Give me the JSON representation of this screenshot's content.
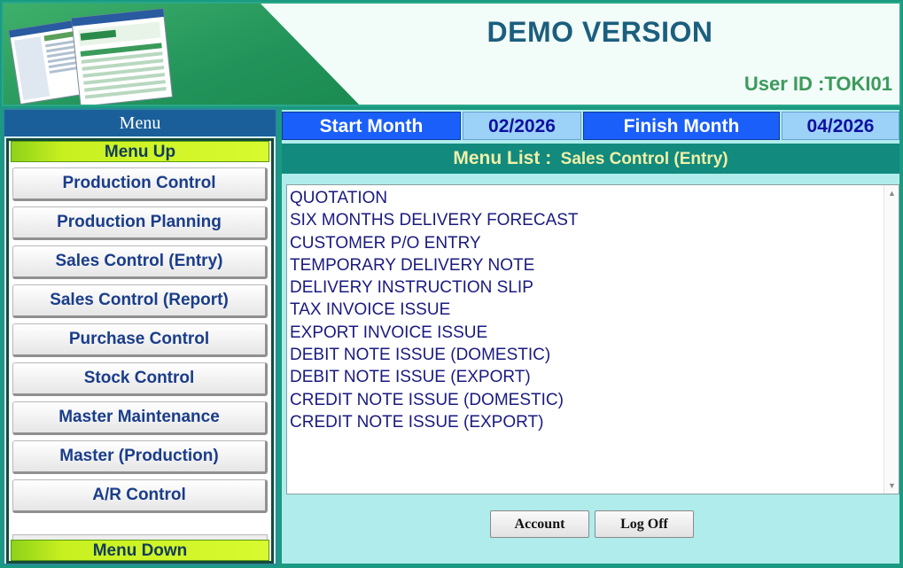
{
  "header": {
    "title": "DEMO VERSION",
    "user_id": "User ID :TOKI01"
  },
  "sidebar": {
    "title": "Menu",
    "menu_up": "Menu Up",
    "menu_down": "Menu Down",
    "items": [
      {
        "label": "Production Control"
      },
      {
        "label": "Production Planning"
      },
      {
        "label": "Sales Control (Entry)"
      },
      {
        "label": "Sales Control (Report)"
      },
      {
        "label": "Purchase Control"
      },
      {
        "label": "Stock Control"
      },
      {
        "label": "Master Maintenance"
      },
      {
        "label": "Master (Production)"
      },
      {
        "label": "A/R Control"
      }
    ]
  },
  "period": {
    "start_label": "Start Month",
    "start_value": "02/2026",
    "finish_label": "Finish Month",
    "finish_value": "04/2026"
  },
  "menu_list": {
    "label": "Menu List :",
    "value": "Sales Control (Entry)",
    "items": [
      "QUOTATION",
      "SIX MONTHS DELIVERY FORECAST",
      "CUSTOMER P/O ENTRY",
      "TEMPORARY DELIVERY NOTE",
      "DELIVERY INSTRUCTION SLIP",
      "TAX INVOICE ISSUE",
      "EXPORT INVOICE ISSUE",
      "DEBIT NOTE ISSUE (DOMESTIC)",
      "DEBIT NOTE ISSUE (EXPORT)",
      "CREDIT NOTE ISSUE (DOMESTIC)",
      "CREDIT NOTE ISSUE (EXPORT)"
    ]
  },
  "actions": {
    "account": "Account",
    "log_off": "Log Off"
  },
  "icons": {
    "scroll_up": "▲",
    "scroll_down": "▼"
  },
  "colors": {
    "header_title": "#1b5e7e",
    "user_id": "#3c9a5c",
    "sidebar_title_bg": "#1a5f9a",
    "period_label_bg": "#1a5ffa",
    "menu_list_bar_bg": "#128a7e",
    "main_bg": "#b0ecec"
  }
}
